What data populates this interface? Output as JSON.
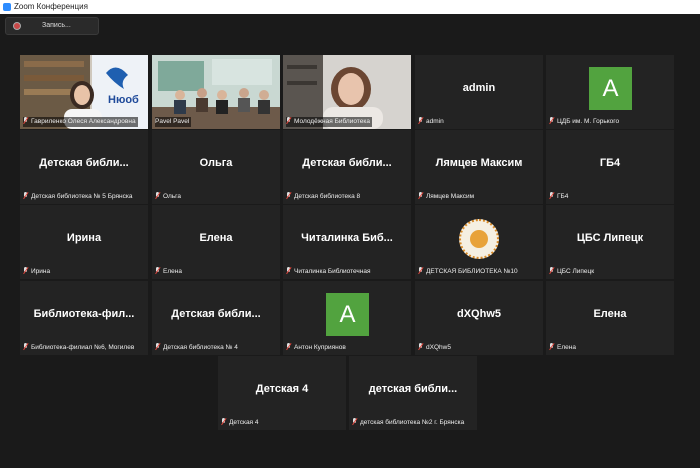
{
  "window": {
    "title": "Zoom Конференция",
    "accent": "#2d8cff"
  },
  "toolbar": {
    "record_label": "Запись..."
  },
  "colors": {
    "tile_bg": "#232323",
    "active_border": "#9ed155",
    "avatar_bg": "#52a33f",
    "muted_icon": "#e0443a"
  },
  "tiles": [
    {
      "display": "",
      "caption": "Гавриленко Олеся Александровна",
      "type": "video"
    },
    {
      "display": "",
      "caption": "Pavel Pavel",
      "type": "video"
    },
    {
      "display": "",
      "caption": "Молодёжная Библиотека",
      "type": "video",
      "active": true
    },
    {
      "display": "admin",
      "caption": "admin"
    },
    {
      "display": "A",
      "caption": "ЦДБ им. М. Горького",
      "type": "avatar"
    },
    {
      "display": "Детская библи...",
      "caption": "Детская библиотека № 5 Брянска"
    },
    {
      "display": "Ольга",
      "caption": "Ольга"
    },
    {
      "display": "Детская библи...",
      "caption": "Детская библиотека 8"
    },
    {
      "display": "Лямцев Максим",
      "caption": "Лямцев Максим"
    },
    {
      "display": "ГБ4",
      "caption": "ГБ4"
    },
    {
      "display": "Ирина",
      "caption": "Ирина"
    },
    {
      "display": "Елена",
      "caption": "Елена"
    },
    {
      "display": "Читалинка Биб...",
      "caption": "Читалинка Библиотечная"
    },
    {
      "display": "",
      "caption": "ДЕТСКАЯ БИБЛИОТЕКА №10",
      "type": "logo"
    },
    {
      "display": "ЦБС Липецк",
      "caption": "ЦБС Липецк"
    },
    {
      "display": "Библиотека-фил...",
      "caption": "Библиотека-филиал №6, Могилев"
    },
    {
      "display": "Детская библи...",
      "caption": "Детская библиотека № 4"
    },
    {
      "display": "A",
      "caption": "Антон Куприянов",
      "type": "avatar"
    },
    {
      "display": "dXQhw5",
      "caption": "dXQhw5"
    },
    {
      "display": "Елена",
      "caption": "Елена"
    },
    {
      "display": "Детская 4",
      "caption": "Детская 4"
    },
    {
      "display": "детская библи...",
      "caption": "детская библиотека №2 г. Брянска"
    }
  ]
}
